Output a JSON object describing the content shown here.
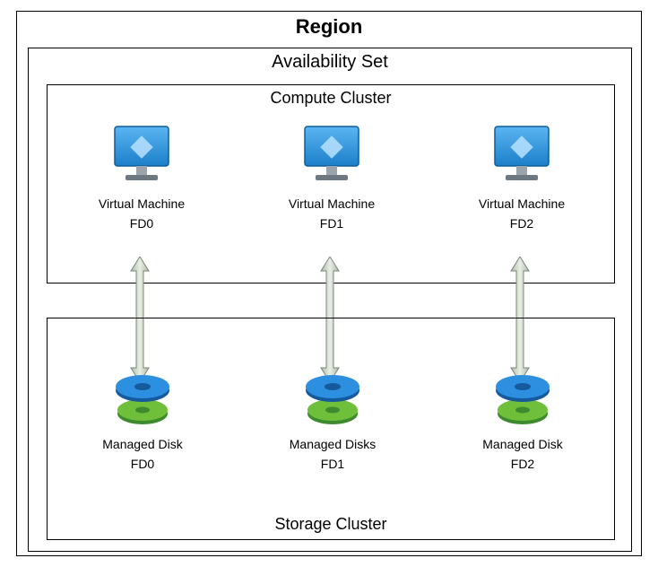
{
  "region": {
    "title": "Region"
  },
  "availability_set": {
    "title": "Availability Set"
  },
  "compute_cluster": {
    "title": "Compute Cluster",
    "vms": [
      {
        "name": "Virtual Machine",
        "fd": "FD0"
      },
      {
        "name": "Virtual Machine",
        "fd": "FD1"
      },
      {
        "name": "Virtual Machine",
        "fd": "FD2"
      }
    ]
  },
  "storage_cluster": {
    "title": "Storage Cluster",
    "disks": [
      {
        "name": "Managed Disk",
        "fd": "FD0"
      },
      {
        "name": "Managed Disks",
        "fd": "FD1"
      },
      {
        "name": "Managed Disk",
        "fd": "FD2"
      }
    ]
  }
}
